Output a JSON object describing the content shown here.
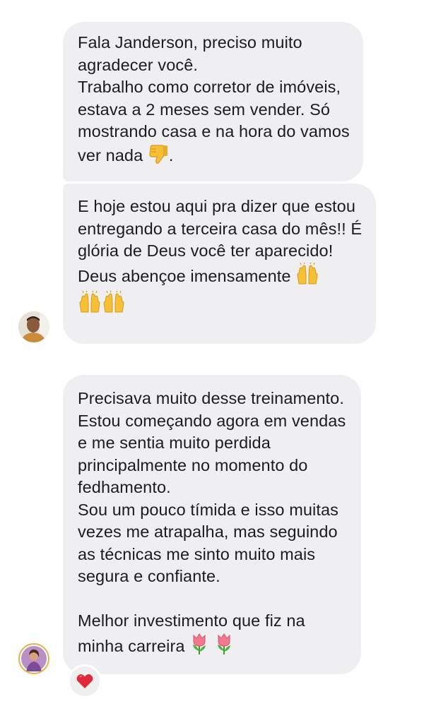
{
  "conversation": {
    "messages": [
      {
        "lines": [
          "Fala Janderson, preciso muito agradecer você.",
          "Trabalho como corretor de imóveis, estava a 2 meses sem vender. Só mostrando casa e na hora do vamos ver nada"
        ],
        "trailing_emoji": "thumbs-down-icon",
        "trailing_text": "."
      },
      {
        "lines": [
          "E hoje estou aqui pra dizer que estou entregando a terceira casa do mês!! É glória de Deus você ter aparecido!",
          "Deus abençoe imensamente"
        ],
        "trailing_emoji": "raising-hands-icon x3"
      },
      {
        "lines": [
          "Precisava muito desse treinamento. Estou começando agora em vendas e me sentia muito perdida principalmente no momento do fedhamento.",
          "Sou um pouco tímida e isso muitas vezes me atrapalha, mas seguindo as técnicas me sinto muito mais segura e confiante.",
          "",
          "Melhor investimento que fiz na minha carreira"
        ],
        "trailing_emoji": "tulip-icon x2",
        "reaction": "heart-icon"
      }
    ],
    "colors": {
      "bubble": "#efeff1",
      "text": "#1c1c1e",
      "heart": "#e0293a",
      "avatar_ring": "#e7b04b"
    }
  }
}
